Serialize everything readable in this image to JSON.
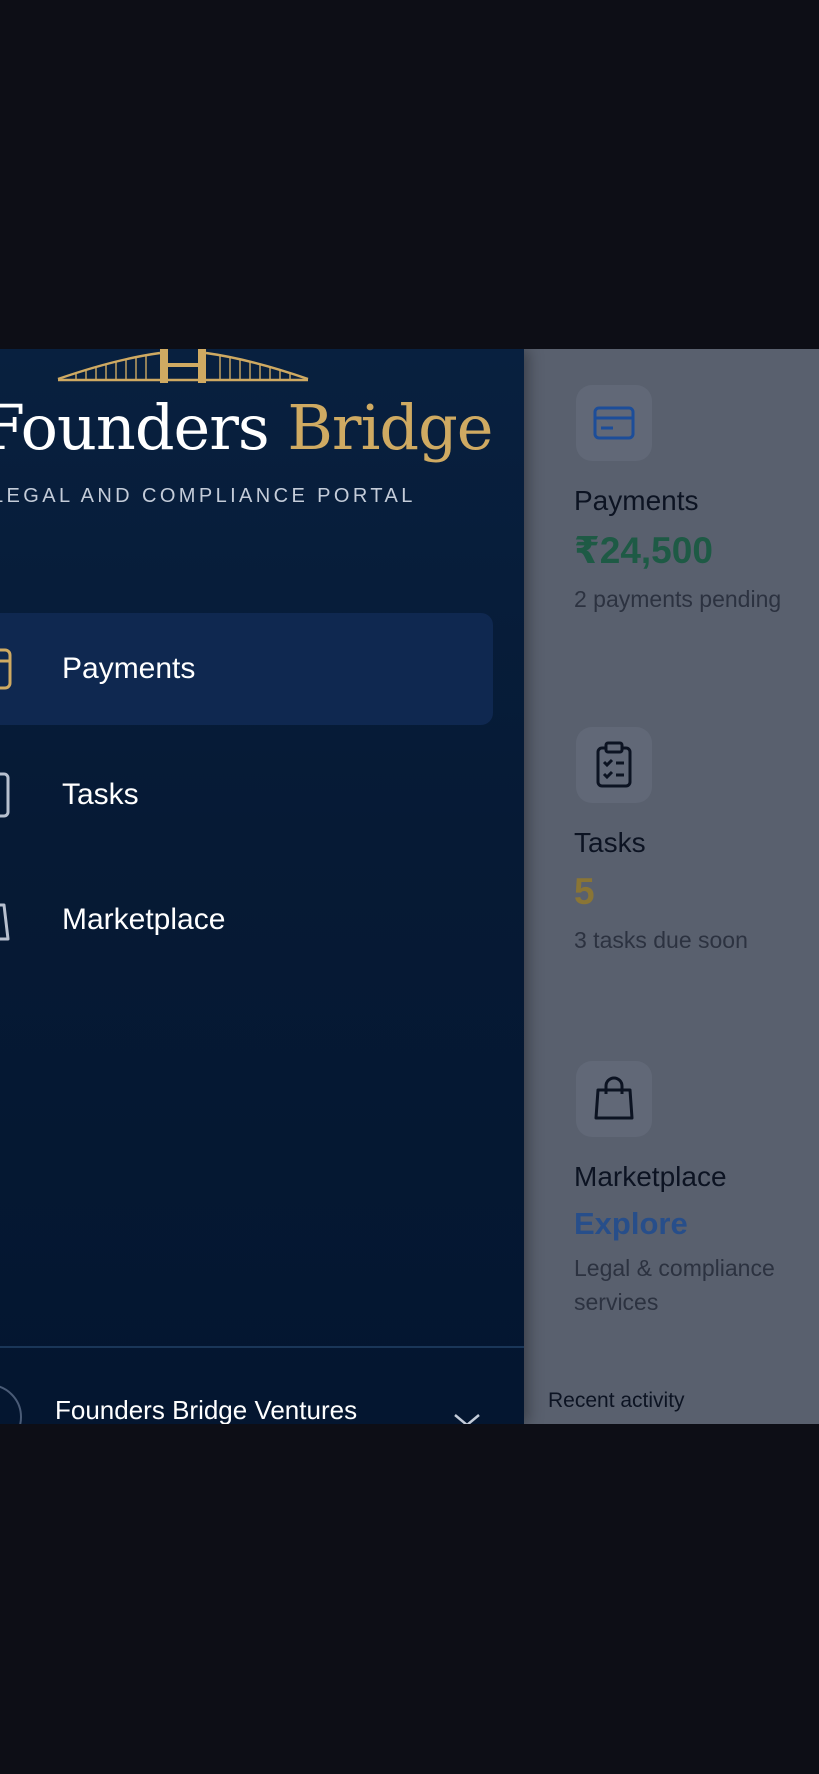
{
  "brand": {
    "name_part1": "Founders",
    "name_part2": "Bridge",
    "tagline": "LEGAL AND COMPLIANCE PORTAL",
    "colors": {
      "gold": "#cfaa62",
      "navy": "#061a35"
    }
  },
  "drawer": {
    "items": [
      {
        "label": "Payments",
        "icon": "card-icon",
        "active": true
      },
      {
        "label": "Tasks",
        "icon": "clipboard-icon",
        "active": false
      },
      {
        "label": "Marketplace",
        "icon": "bag-icon",
        "active": false
      }
    ],
    "account": {
      "name": "Founders Bridge Ventures",
      "icon": "chevron-down-icon"
    }
  },
  "cards": [
    {
      "title": "Payments",
      "value": "₹24,500",
      "subtitle": "2 payments pending",
      "icon": "credit-card-icon",
      "value_color": "#1e5a45"
    },
    {
      "title": "Tasks",
      "value": "5",
      "subtitle": "3 tasks due soon",
      "icon": "clipboard-list-icon",
      "value_color": "#8a7535"
    },
    {
      "title": "Marketplace",
      "value": "Explore",
      "subtitle": "Legal & compliance services",
      "icon": "shopping-bag-icon",
      "value_color": "#274e8a"
    }
  ],
  "recent_activity": {
    "label": "Recent activity"
  }
}
